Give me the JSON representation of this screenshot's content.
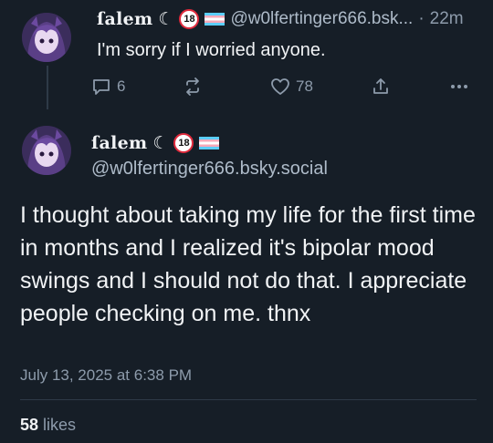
{
  "reply": {
    "author_name": "ſalem",
    "moon": "☾",
    "age_badge": "18",
    "handle": "@w0lfertinger666.bsk...",
    "separator": "·",
    "time": "22m",
    "text": "I'm sorry if I worried anyone.",
    "replies_count": "6",
    "likes_count": "78"
  },
  "post": {
    "author_name": "ſalem",
    "moon": "☾",
    "age_badge": "18",
    "handle": "@w0lfertinger666.bsky.social",
    "text": "I thought about taking my life for the first time in months and I realized it's bipolar mood swings and I should not do that. I appreciate people checking on me. thnx",
    "timestamp": "July 13, 2025 at 6:38 PM",
    "likes_count": "58",
    "likes_label": "likes"
  },
  "icons": {
    "reply": "speech-bubble-icon",
    "repost": "repost-arrows-icon",
    "like": "heart-icon",
    "share": "share-icon",
    "more": "ellipsis-icon",
    "flag": "trans-flag-icon"
  },
  "colors": {
    "background": "#161e27",
    "text": "#f1f3f5",
    "muted": "#8d9bab",
    "divider": "#2e3a47",
    "badge_ring": "#e02a3c"
  }
}
